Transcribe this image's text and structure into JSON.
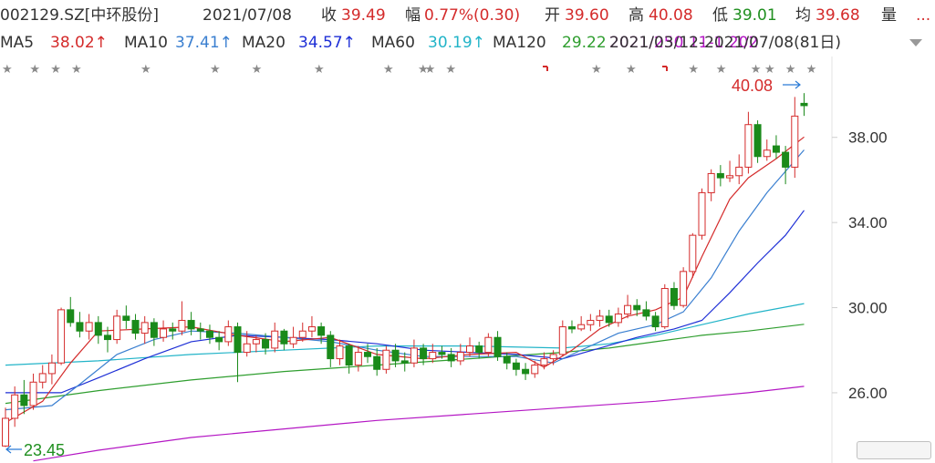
{
  "header": {
    "ticker": "002129.SZ[中环股份]",
    "date": "2021/07/08",
    "close_label": "收",
    "close_value": "39.49",
    "change_label": "幅",
    "change_value": "0.77%(0.30)",
    "open_label": "开",
    "open_value": "39.60",
    "high_label": "高",
    "high_value": "40.08",
    "low_label": "低",
    "low_value": "39.01",
    "avg_label": "均",
    "avg_value": "39.68",
    "volume_label": "量",
    "more": "..."
  },
  "ma_bar": {
    "items": [
      {
        "label": "MA5",
        "value": "38.02↑",
        "color": "#d42b2b"
      },
      {
        "label": "MA10",
        "value": "37.41↑",
        "color": "#3a7fd0"
      },
      {
        "label": "MA20",
        "value": "34.57↑",
        "color": "#1e2fd6"
      },
      {
        "label": "MA60",
        "value": "30.19↑",
        "color": "#22b4c8"
      },
      {
        "label": "MA120",
        "value": "29.22",
        "color": "#2f9e2f"
      }
    ],
    "range_text": "2021/03/12-2021/07/08(81日)",
    "overlap_text": "2021/250 11-1.202"
  },
  "chart_data": {
    "type": "candlestick",
    "ylim": [
      22.7,
      41.8
    ],
    "yticks": [
      "38.00",
      "34.00",
      "30.00",
      "26.00"
    ],
    "ytick_values": [
      38,
      34,
      30,
      26
    ],
    "colors": {
      "up": "#d42b2b",
      "down": "#1a8a1a",
      "ma5": "#d42b2b",
      "ma10": "#3a7fd0",
      "ma20": "#1e2fd6",
      "ma60": "#22b4c8",
      "ma120": "#2f9e2f",
      "ma250": "#b417c4"
    },
    "annotations": {
      "high": "40.08",
      "low": "23.45"
    },
    "candles": [
      [
        23.5,
        24.8,
        25.3,
        23.45
      ],
      [
        24.8,
        25.9,
        26.3,
        24.4
      ],
      [
        25.9,
        25.4,
        26.6,
        25.0
      ],
      [
        25.4,
        26.5,
        26.9,
        25.2
      ],
      [
        26.5,
        26.9,
        27.3,
        26.2
      ],
      [
        26.9,
        27.4,
        27.8,
        26.4
      ],
      [
        27.4,
        29.9,
        30.0,
        27.3
      ],
      [
        29.9,
        29.3,
        30.5,
        29.1
      ],
      [
        29.3,
        28.9,
        29.8,
        28.6
      ],
      [
        28.9,
        29.3,
        29.7,
        28.5
      ],
      [
        29.3,
        28.7,
        29.6,
        28.3
      ],
      [
        28.7,
        28.5,
        29.1,
        27.9
      ],
      [
        28.5,
        29.6,
        29.9,
        28.3
      ],
      [
        29.6,
        29.4,
        30.1,
        29.0
      ],
      [
        29.4,
        28.8,
        29.7,
        28.5
      ],
      [
        28.8,
        29.3,
        29.6,
        28.3
      ],
      [
        29.3,
        28.6,
        29.5,
        28.2
      ],
      [
        28.6,
        29.0,
        29.4,
        28.4
      ],
      [
        29.0,
        28.9,
        29.3,
        28.5
      ],
      [
        28.9,
        29.4,
        30.3,
        28.7
      ],
      [
        29.4,
        29.0,
        29.8,
        28.7
      ],
      [
        29.0,
        28.9,
        29.3,
        28.5
      ],
      [
        28.9,
        28.6,
        29.2,
        28.3
      ],
      [
        28.6,
        28.4,
        28.9,
        28.0
      ],
      [
        28.4,
        29.1,
        29.4,
        28.2
      ],
      [
        29.1,
        27.9,
        29.3,
        26.5
      ],
      [
        27.9,
        28.3,
        28.9,
        27.7
      ],
      [
        28.3,
        28.5,
        28.7,
        27.9
      ],
      [
        28.5,
        28.1,
        28.8,
        27.8
      ],
      [
        28.1,
        28.9,
        29.3,
        27.9
      ],
      [
        28.9,
        28.3,
        29.0,
        28.0
      ],
      [
        28.3,
        28.6,
        29.1,
        28.1
      ],
      [
        28.6,
        28.9,
        29.3,
        28.4
      ],
      [
        28.9,
        29.1,
        29.6,
        28.6
      ],
      [
        29.1,
        28.7,
        29.3,
        28.3
      ],
      [
        28.7,
        27.6,
        28.9,
        27.2
      ],
      [
        27.6,
        28.2,
        28.5,
        27.3
      ],
      [
        28.2,
        27.3,
        28.3,
        26.9
      ],
      [
        27.3,
        27.9,
        28.2,
        27.0
      ],
      [
        27.9,
        27.7,
        28.3,
        27.4
      ],
      [
        27.7,
        27.1,
        28.1,
        26.8
      ],
      [
        27.1,
        28.0,
        28.2,
        26.9
      ],
      [
        28.0,
        27.5,
        28.3,
        27.2
      ],
      [
        27.5,
        27.4,
        27.9,
        27.0
      ],
      [
        27.4,
        28.1,
        28.5,
        27.2
      ],
      [
        28.1,
        27.6,
        28.3,
        27.3
      ],
      [
        27.6,
        27.9,
        28.3,
        27.4
      ],
      [
        27.9,
        27.8,
        28.2,
        27.6
      ],
      [
        27.8,
        27.5,
        28.1,
        27.2
      ],
      [
        27.5,
        27.9,
        28.3,
        27.3
      ],
      [
        27.9,
        28.2,
        28.6,
        27.7
      ],
      [
        28.2,
        27.9,
        28.4,
        27.6
      ],
      [
        27.9,
        28.6,
        28.8,
        27.7
      ],
      [
        28.6,
        27.7,
        28.9,
        27.5
      ],
      [
        27.7,
        27.4,
        27.9,
        27.1
      ],
      [
        27.4,
        27.1,
        27.6,
        26.8
      ],
      [
        27.1,
        26.9,
        27.4,
        26.6
      ],
      [
        26.9,
        27.3,
        27.5,
        26.7
      ],
      [
        27.3,
        27.6,
        27.9,
        27.1
      ],
      [
        27.6,
        27.8,
        28.0,
        27.3
      ],
      [
        27.8,
        29.1,
        29.4,
        27.7
      ],
      [
        29.1,
        29.0,
        29.4,
        28.8
      ],
      [
        29.0,
        29.2,
        29.6,
        28.9
      ],
      [
        29.2,
        29.4,
        29.7,
        28.9
      ],
      [
        29.4,
        29.6,
        29.9,
        29.1
      ],
      [
        29.6,
        29.3,
        29.9,
        29.1
      ],
      [
        29.3,
        29.7,
        30.0,
        29.1
      ],
      [
        29.7,
        30.1,
        30.6,
        29.5
      ],
      [
        30.1,
        29.9,
        30.4,
        29.6
      ],
      [
        29.9,
        29.6,
        30.3,
        29.4
      ],
      [
        29.6,
        29.1,
        29.8,
        28.9
      ],
      [
        29.1,
        30.9,
        31.1,
        29.0
      ],
      [
        30.9,
        30.1,
        31.2,
        29.9
      ],
      [
        30.1,
        31.7,
        31.9,
        30.0
      ],
      [
        31.7,
        33.4,
        33.5,
        31.4
      ],
      [
        33.4,
        35.4,
        35.6,
        33.2
      ],
      [
        35.4,
        36.3,
        36.5,
        35.0
      ],
      [
        36.3,
        36.1,
        36.7,
        35.7
      ],
      [
        36.1,
        36.2,
        36.9,
        35.9
      ],
      [
        36.2,
        36.6,
        37.2,
        35.8
      ],
      [
        36.6,
        38.6,
        39.2,
        36.3
      ],
      [
        38.6,
        37.1,
        38.8,
        36.8
      ],
      [
        37.1,
        37.4,
        37.9,
        36.9
      ],
      [
        37.6,
        37.3,
        38.1,
        37.0
      ],
      [
        37.3,
        36.6,
        37.6,
        35.8
      ],
      [
        36.6,
        39.0,
        39.9,
        36.1
      ],
      [
        39.6,
        39.49,
        40.08,
        39.01
      ]
    ],
    "ma_lines": {
      "ma5": [
        [
          0,
          24.6
        ],
        [
          4,
          25.6
        ],
        [
          7,
          27.4
        ],
        [
          10,
          28.9
        ],
        [
          15,
          29.0
        ],
        [
          20,
          29.1
        ],
        [
          25,
          28.7
        ],
        [
          30,
          28.4
        ],
        [
          35,
          28.6
        ],
        [
          40,
          27.8
        ],
        [
          45,
          27.6
        ],
        [
          50,
          27.8
        ],
        [
          55,
          27.9
        ],
        [
          58,
          27.2
        ],
        [
          61,
          28.0
        ],
        [
          64,
          29.0
        ],
        [
          67,
          29.6
        ],
        [
          70,
          29.9
        ],
        [
          73,
          30.5
        ],
        [
          75,
          32.4
        ],
        [
          78,
          35.1
        ],
        [
          80,
          36.1
        ],
        [
          83,
          37.0
        ],
        [
          86,
          38.02
        ]
      ],
      "ma10": [
        [
          0,
          25.2
        ],
        [
          5,
          25.4
        ],
        [
          8,
          26.4
        ],
        [
          12,
          27.8
        ],
        [
          16,
          28.5
        ],
        [
          20,
          28.9
        ],
        [
          25,
          28.8
        ],
        [
          30,
          28.6
        ],
        [
          35,
          28.4
        ],
        [
          40,
          28.0
        ],
        [
          45,
          27.7
        ],
        [
          50,
          27.7
        ],
        [
          55,
          27.7
        ],
        [
          59,
          27.4
        ],
        [
          62,
          28.0
        ],
        [
          66,
          28.8
        ],
        [
          70,
          29.2
        ],
        [
          73,
          29.8
        ],
        [
          76,
          31.4
        ],
        [
          79,
          33.6
        ],
        [
          82,
          35.4
        ],
        [
          86,
          37.41
        ]
      ],
      "ma20": [
        [
          0,
          26.0
        ],
        [
          6,
          26.0
        ],
        [
          10,
          26.7
        ],
        [
          15,
          27.6
        ],
        [
          20,
          28.4
        ],
        [
          25,
          28.7
        ],
        [
          30,
          28.6
        ],
        [
          35,
          28.5
        ],
        [
          40,
          28.3
        ],
        [
          45,
          28.0
        ],
        [
          50,
          27.9
        ],
        [
          55,
          27.8
        ],
        [
          60,
          27.6
        ],
        [
          64,
          28.1
        ],
        [
          68,
          28.6
        ],
        [
          72,
          29.0
        ],
        [
          75,
          29.4
        ],
        [
          78,
          30.7
        ],
        [
          81,
          32.1
        ],
        [
          84,
          33.4
        ],
        [
          86,
          34.57
        ]
      ],
      "ma60": [
        [
          0,
          27.3
        ],
        [
          10,
          27.5
        ],
        [
          20,
          27.8
        ],
        [
          30,
          28.0
        ],
        [
          40,
          28.2
        ],
        [
          50,
          28.2
        ],
        [
          60,
          28.1
        ],
        [
          65,
          28.3
        ],
        [
          70,
          28.7
        ],
        [
          75,
          29.2
        ],
        [
          80,
          29.7
        ],
        [
          86,
          30.19
        ]
      ],
      "ma120": [
        [
          0,
          25.5
        ],
        [
          10,
          26.1
        ],
        [
          20,
          26.6
        ],
        [
          30,
          27.0
        ],
        [
          40,
          27.3
        ],
        [
          50,
          27.6
        ],
        [
          60,
          27.9
        ],
        [
          65,
          28.1
        ],
        [
          70,
          28.4
        ],
        [
          75,
          28.7
        ],
        [
          80,
          28.9
        ],
        [
          86,
          29.22
        ]
      ],
      "ma250": [
        [
          3,
          22.8
        ],
        [
          10,
          23.3
        ],
        [
          20,
          23.9
        ],
        [
          30,
          24.3
        ],
        [
          40,
          24.7
        ],
        [
          50,
          25.0
        ],
        [
          60,
          25.3
        ],
        [
          70,
          25.6
        ],
        [
          80,
          26.0
        ],
        [
          86,
          26.3
        ]
      ]
    },
    "star_positions": [
      0,
      4,
      7,
      10,
      20,
      30,
      36,
      45,
      55,
      60,
      61,
      64,
      85,
      90,
      99,
      103,
      108,
      110,
      113,
      116
    ]
  }
}
